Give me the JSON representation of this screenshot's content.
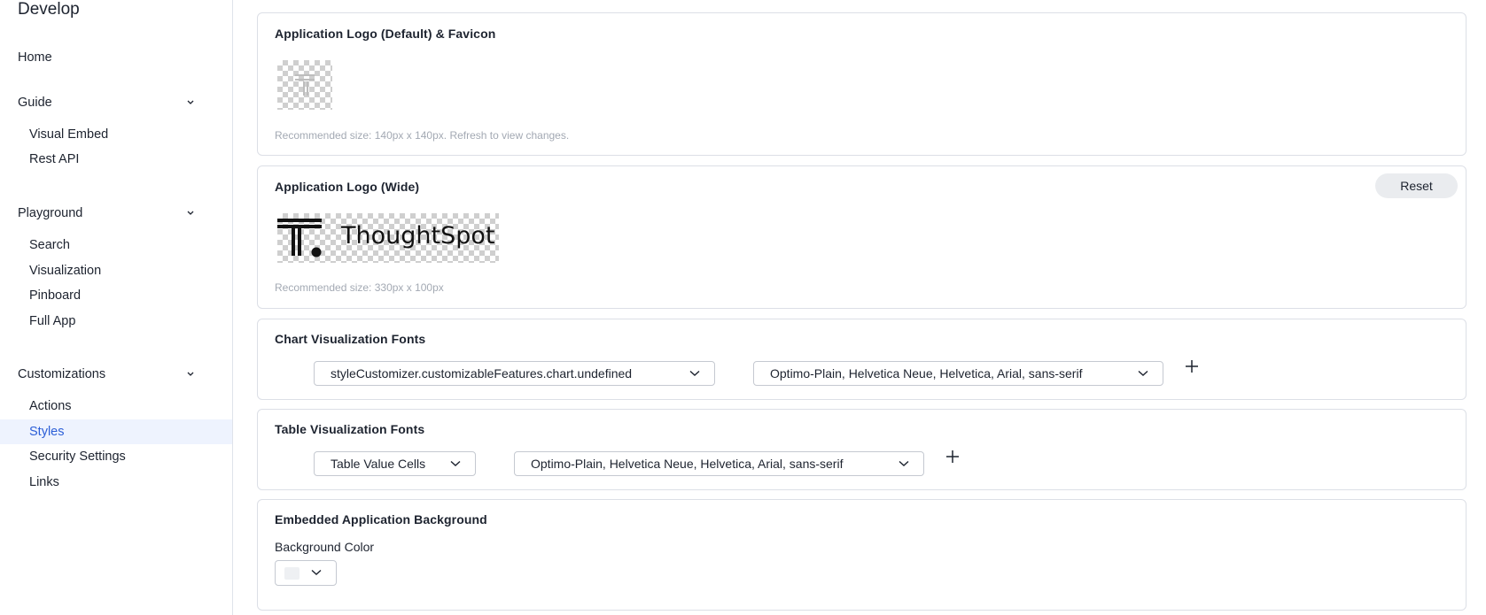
{
  "sidebar": {
    "title": "Develop",
    "home": "Home",
    "sections": [
      {
        "label": "Guide",
        "items": [
          "Visual Embed",
          "Rest API"
        ]
      },
      {
        "label": "Playground",
        "items": [
          "Search",
          "Visualization",
          "Pinboard",
          "Full App"
        ]
      },
      {
        "label": "Customizations",
        "items": [
          "Actions",
          "Styles",
          "Security Settings",
          "Links"
        ],
        "active": "Styles"
      }
    ]
  },
  "cards": {
    "logo_default": {
      "title": "Application Logo (Default) & Favicon",
      "hint": "Recommended size: 140px x 140px. Refresh to view changes."
    },
    "logo_wide": {
      "title": "Application Logo (Wide)",
      "reset_label": "Reset",
      "logo_text": "ThoughtSpot",
      "hint": "Recommended size: 330px x 100px"
    },
    "chart_fonts": {
      "title": "Chart Visualization Fonts",
      "target_select": "styleCustomizer.customizableFeatures.chart.undefined",
      "font_select": "Optimo-Plain, Helvetica Neue, Helvetica, Arial, sans-serif"
    },
    "table_fonts": {
      "title": "Table Visualization Fonts",
      "target_select": "Table Value Cells",
      "font_select": "Optimo-Plain, Helvetica Neue, Helvetica, Arial, sans-serif"
    },
    "background": {
      "title": "Embedded Application Background",
      "field_label": "Background Color",
      "swatch_color": "#eef0f3"
    }
  },
  "colors": {
    "accent": "#2c5fd7",
    "active_bg": "#eef3fe",
    "border": "#dcdfe6",
    "hint": "#a3a9b3"
  }
}
